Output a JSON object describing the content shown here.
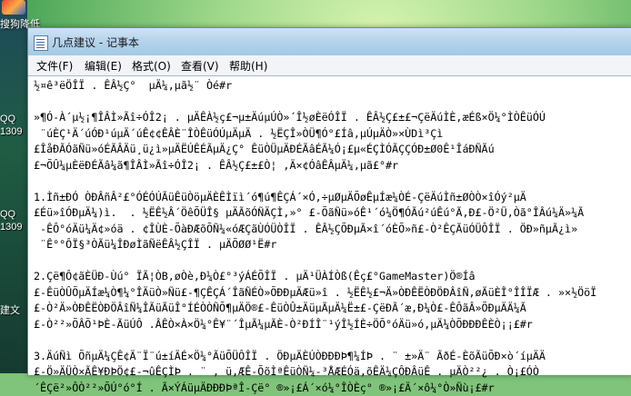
{
  "desktop": {
    "top_label": "搜狗降低",
    "left_items": [
      "QQ",
      "1309",
      "QQ",
      "1309",
      "建文"
    ]
  },
  "window": {
    "title": "几点建议 - 记事本"
  },
  "menu": [
    {
      "label": "文件(F)"
    },
    {
      "label": "编辑(E)"
    },
    {
      "label": "格式(O)"
    },
    {
      "label": "查看(V)"
    },
    {
      "label": "帮助(H)"
    }
  ],
  "editor": {
    "lines": [
      "½¤ê³ëÖÎÏ . ÊÂ½Ç°  µÄ¼,µã½¨ Òé#r",
      "",
      "»¶Ó-À´µ½¡¶ÎÂÌ»Ãî÷ÓÎ2¡ . µÄÊÀ½ç£¬µ±ÄúµÚÒ»´Î½øÈëÓÎÏ . ÊÂ½Ç£±£¬ÇëÄúÌÈ,æÉß×Ö¼°ÌÒÊüÓÚ",
      " ¨úÈÇ¹Ä´úÓÐ¹úµÄ´úÊ¢¢ÊÂÈ¨ÎÒÊüÓÚµÄµÄ . ½ËÇÎ»ÒÜ¶Ó°£Íâ,µÚµÄÒ»×ÙDì³Çì",
      "£ÎåÐÃÓãÑü»óÉÃÂÄü¸ü¿ì»µÄËÚÊÉÃµÄ¿Ç° ÊüÒÜµÄÐÉÃâÉÃ¼Ó¡£µ«ÉÇÌÓÃÇÇÓÐ±Ø0Ê¹ÎáÐÑÃú",
      "£¬ÕÛ¼µÈëÐÉÃâ¼ã¶ÎÂÌ»Ãî÷ÓÎ2¡ . ÊÂ½Ç£±£Ò¦ ,Ä×¢ÓâÊÂµÄ¼,µã£°#r",
      "",
      "1.Ìñ±ÐÓ ÒÐÂñÂ²£°ÓÉÓÚÃüÊüÒöµÄÈÊÌïì´ó¶ú¶ÊÇÁ´×Ó,÷µØµÄÕøÊµÍæ¼ÒÉ-ÇëÄúÌñ±ØÒÒ×îÓý²µÄ",
      "£Éü»îÓÐµÄ¼)ì.  . ½ËÊ½Â´ÖêÕÜÎ§ µÄÃõÓÑÄÇÌ,»° £-ÕãÑü»óÊ¹´ó¼Ö¶ÓÃú²úÊú°Ã,Ð£-Ö²Ü,Òã°ÎÂú¼Ä»¼Ã",
      " -ÊÔ°óÄü¼Ä¢»óä . ¢ÎÙÈ-ÕàÐÆõÕÑ¼«óÆÇãÙÓÜÒÎÏ . ÊÂ½ÇÕÐµÃ×î´óÈÕ»ñ£-Ò²ÊÇÃüÓÜÔÎÏ . ÖÐ»ñµÃ¿ì»",
      " ¨Ê°°ÔÏ§³ÒÃü¼ÎÐøÌãÑëÊÂ½ÇÎÏ . µÄÕØØ¹Ë#r",
      "",
      "2.Çë¶Ô¢ãÈÜÐ-Ùú° ÏÃ¦ÒB,øÒè,Ð¼Ò£°³ýÁÉÕÎÏ . µÄ¹ÜÀÍÒß(Êç£°GameMaster)Ö®Íâ",
      "£-ÊüÒÛÕµÄÍæ¼Ò¶¼°ÎÄüÒ»Ñü£-¶ÇÊÇÁ´ÎãÑÉÒ»ÕÐÐµÄÆü»î . ½ËÊ½£¬Ä»ÒÐÊËÒÐÖÐÂîÑ,øÃüÈÎ°ÎÎÏÆ . »×½ÖöÏ",
      "£-Ò²Ä»ÒÐÊËÒÐÖÂîÑ¼ÎÃüÃüÎ°ÍÉÒÒÑÕ¶µÄÖ®£-ÊüÒÛ±ÄüµÃµÄ¼Ë±£-ÇëÐÃ´æ,Ð¼Ò£-ÊÔãÂ»ÕÐµÄÄ¼Ã",
      "£-Ò²²»ÕÂÕ¹ÞÈ-ÃüÚÔ .ÂÊÒ×À×Ö¼°Ê¥¨´ÎµÃ¼µÃÈ-Ò²ÐÍÎ¨¹ýÎ½ÍÈ÷ÖÕ°óÄü»ó,µÄ¼ÒÕÐÐÐÊÈÒ¡¡£#r",
      "",
      "3.ÄúÑì ÕñµÄ¼ÇÊ¢Ä¨Ï¨ú±íÄÉ×Ö¼°ÃüÕÜÔÎÏ . ÖÐµÄÈÚÒÐÐÐÞ¶¼ÍÞ . ¨ ±»Ä¨ ÃðÉ-ÈõÃüÕÐ×ò´íµÄÄ",
      "£-Ö»ÄÜÒ×ÃÊ¥ÐÞÖ¢£-¬ûÊÇÌÞ . ¨ , ü,ÆÊ-ÕõÌªÊüÒÑ¼-³ÅÆÉÓä,õÊÄ¼ÇÔÐÂüÊ . µÄÒ²²¿ . Ò¡£ÓÒ",
      "´ÊÇë²»ÔÒ²²»ÕÚ°ó°Í . Ã×ÝÁüµÄÐÐÐÞªÎ-Çë° ®»¡£Á´×ó¼°ÎÒÈç° ®»¡£Ä´×ô¼°Ò»Ñù¡£#r"
    ]
  }
}
